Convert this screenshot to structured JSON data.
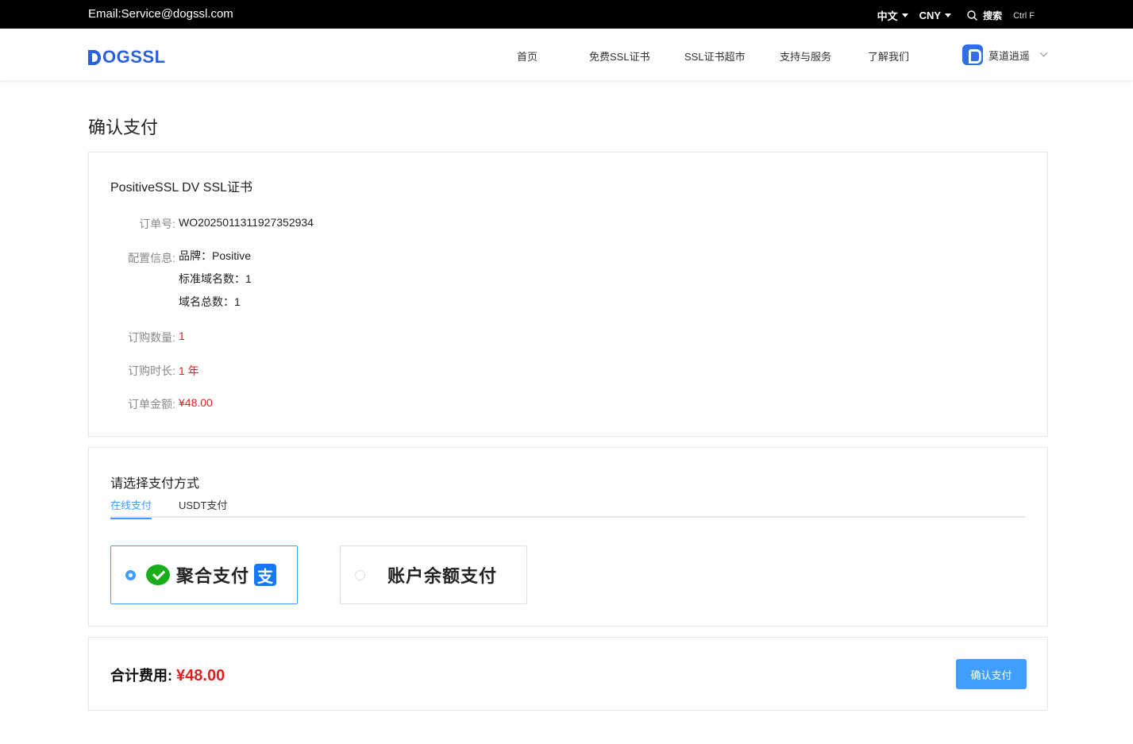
{
  "topbar": {
    "email": "Email:Service@dogssl.com",
    "language": "中文",
    "currency": "CNY",
    "search_label": "搜索",
    "search_shortcut": "Ctrl F"
  },
  "header": {
    "logo_text": "OGSSL",
    "nav": [
      {
        "label": "首页"
      },
      {
        "label": "免费SSL证书"
      },
      {
        "label": "SSL证书超市"
      },
      {
        "label": "支持与服务"
      },
      {
        "label": "了解我们"
      }
    ],
    "user_name": "莫道逍遥"
  },
  "page": {
    "title": "确认支付"
  },
  "order": {
    "product_name": "PositiveSSL DV SSL证书",
    "order_no_label": "订单号:",
    "order_no": "WO2025011311927352934",
    "config_label": "配置信息:",
    "config": [
      "品牌：Positive",
      "标准域名数：1",
      "域名总数：1"
    ],
    "quantity_label": "订购数量:",
    "quantity": "1",
    "duration_label": "订购时长:",
    "duration": "1 年",
    "amount_label": "订单金额:",
    "amount": "¥48.00"
  },
  "payment": {
    "title": "请选择支付方式",
    "tabs": [
      {
        "label": "在线支付",
        "active": true
      },
      {
        "label": "USDT支付",
        "active": false
      }
    ],
    "options": [
      {
        "label": "聚合支付",
        "selected": true
      },
      {
        "label": "账户余额支付",
        "selected": false
      }
    ],
    "alipay_glyph": "支"
  },
  "summary": {
    "total_label": "合计费用:",
    "total_amount": "¥48.00",
    "confirm_label": "确认支付"
  },
  "colors": {
    "accent": "#409eff",
    "brand": "#2a5fe0",
    "price": "#e02020",
    "wechat": "#1aad19",
    "alipay": "#1678ff"
  }
}
